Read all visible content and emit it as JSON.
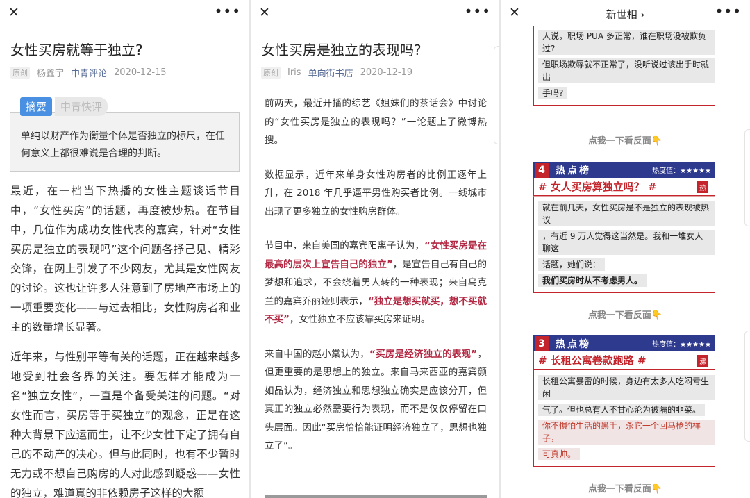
{
  "panel1": {
    "title": "女性买房就等于独立?",
    "meta": {
      "tag": "原创",
      "author": "杨鑫宇",
      "account": "中青评论",
      "date": "2020-12-15"
    },
    "summary_tab": "摘要",
    "summary_tab2": "中青快评",
    "summary": "单纯以财产作为衡量个体是否独立的标尺，在任何意义上都很难说是合理的判断。",
    "paragraphs": [
      "最近，在一档当下热播的女性主题谈话节目中，“女性买房”的话题，再度被炒热。在节目中，几位作为成功女性代表的嘉宾，针对“女性买房是独立的表现吗”这个问题各抒己见、精彩交锋，在网上引发了不少网友，尤其是女性网友的讨论。这也让许多人注意到了房地产市场上的一项重要变化——与过去相比，女性购房者和业主的数量增长显著。",
      "近年来，与性别平等有关的话题，正在越来越多地受到社会各界的关注。要怎样才能成为一名“独立女性”，一直是个备受关注的问题。“对女性而言，买房等于买独立”的观念，正是在这种大背景下应运而生，让不少女性下定了拥有自己的不动产的决心。但与此同时，也有不少暂时无力或不想自己购房的人对此感到疑惑——女性的独立，难道真的非依赖房子这样的大额"
    ]
  },
  "panel2": {
    "title": "女性买房是独立的表现吗?",
    "meta": {
      "tag": "原创",
      "author": "Iris",
      "account": "单向街书店",
      "date": "2020-12-19"
    },
    "p1": "前两天，最近开播的综艺《姐妹们的茶话会》中讨论的“女性买房是独立的表现吗？”一论题上了微博热搜。",
    "p2": "数据显示，近年来单身女性购房者的比例正逐年上升，在 2018 年几乎逼平男性购买者比例。一线城市出现了更多独立的女性购房群体。",
    "p3a": "节目中，来自美国的嘉宾阳离子认为，",
    "p3hl1": "“女性买房是在最高的层次上宣告自己的独立”",
    "p3b": "，是宣告自己有自己的梦想和追求，不会绕着男人转的一种表现；来自乌克兰的嘉宾乔丽娅则表示，",
    "p3hl2": "“独立是想买就买，想不买就不买”",
    "p3c": "，女性独立不应该靠买房来证明。",
    "p4a": "来自中国的赵小棠认为，",
    "p4hl": "“买房是经济独立的表现”",
    "p4b": "，但更重要的是思想上的独立。来自马来西亚的嘉宾颜如晶认为，经济独立和思想独立确实是应该分开，但真正的独立必然需要行为表现，而不是仅仅停留在口头层面。因此“买房恰恰能证明经济独立了，思想也独立了”。"
  },
  "panel3": {
    "title": "新世相 ›",
    "top_lines": [
      "人说，职场 PUA 多正常，谁在职场没被欺负过?",
      "但职场欺辱就不正常了，没听说过该出手时就出",
      "手吗?"
    ],
    "flip": "点我一下看反面👇",
    "flip_bottom": "点我一下看反面👇",
    "card1": {
      "rank": "4",
      "board": "热点榜",
      "heat": "热度值：★★★★★",
      "topic": "# 女人买房算独立吗？ #",
      "badge": "热",
      "lines": [
        "就在前几天，女性买房是不是独立的表现被热议",
        "，有近 9 万人觉得这当然是。我和一堆女人聊这",
        "话题，她们说：",
        "我们买房时从不考虑男人。"
      ]
    },
    "card2": {
      "rank": "3",
      "board": "热点榜",
      "heat": "热度值：★★★★★",
      "topic": "# 长租公寓卷款跑路 #",
      "badge": "沸",
      "lines": [
        "长租公寓暴雷的时候，身边有太多人吃闷亏生闲",
        "气了。但也总有人不甘心沦为被隔的韭菜。"
      ],
      "red_lines": [
        "你不惧怕生活的黑手，杀它一个回马枪的样子，",
        "可真帅。"
      ]
    }
  }
}
